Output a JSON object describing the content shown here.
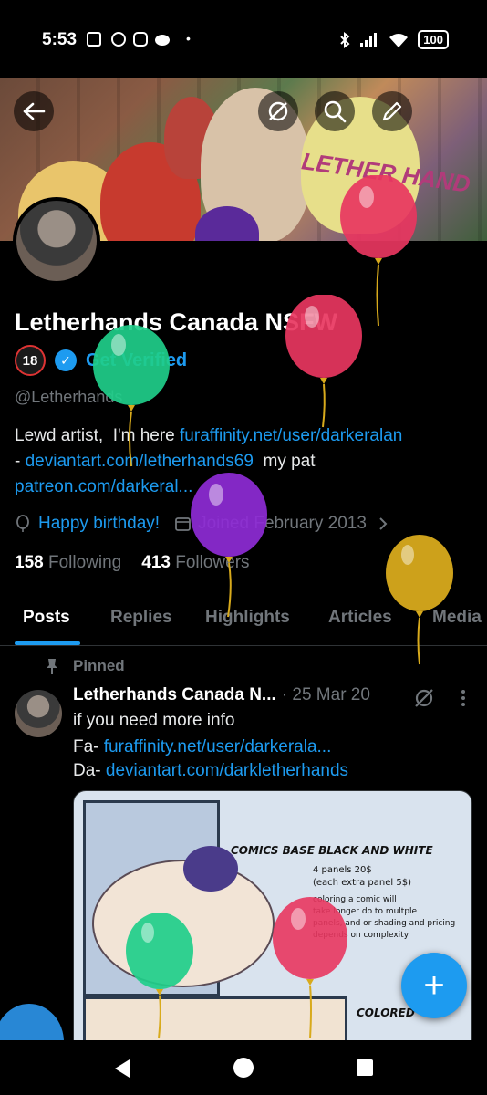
{
  "status_bar": {
    "time": "5:53",
    "battery": "100"
  },
  "banner": {
    "title": "LETHER HAND"
  },
  "profile": {
    "name": "Letherhands Canada NSFW",
    "age_badge": "18",
    "get_verified": "Get Verified",
    "handle": "@Letherhands",
    "bio": {
      "line1_text": "Lewd artist,  I'm here ",
      "line1_link": "furaffinity.net/user/darkeralan",
      "line2_prefix": "- ",
      "line2_link": "deviantart.com/letherhands69",
      "line2_text": "  my pat",
      "line3_link": "patreon.com/darkeral..."
    },
    "birthday": "Happy birthday!",
    "joined": "Joined February 2013",
    "following_count": "158",
    "following_label": "Following",
    "followers_count": "413",
    "followers_label": "Followers"
  },
  "tabs": [
    "Posts",
    "Replies",
    "Highlights",
    "Articles",
    "Media"
  ],
  "post": {
    "pinned_label": "Pinned",
    "author": "Letherhands Canada N...",
    "date": "· 25 Mar 20",
    "line1": "if you need more info",
    "line2_prefix": "Fa- ",
    "line2_link": "furaffinity.net/user/darkerala...",
    "line3_prefix": "Da- ",
    "line3_link": "deviantart.com/darkletherhands",
    "image_text": {
      "heading": "COMICS BASE BLACK AND WHITE",
      "price1": "4 panels 20$",
      "price2": "(each extra panel 5$)",
      "note1": "coloring a comic will",
      "note2": "take longer do to multple",
      "note3": "panels, and or shading and pricing",
      "note4": "depends on complexity",
      "colored": "COLORED"
    }
  },
  "fab_label": "+",
  "colors": {
    "accent": "#1d9bf0",
    "background": "#000000",
    "muted": "#71767b",
    "balloon_red": "#e8365f",
    "balloon_green": "#1fce8a",
    "balloon_purple": "#8e2bd6",
    "balloon_gold": "#d8aa1c"
  }
}
